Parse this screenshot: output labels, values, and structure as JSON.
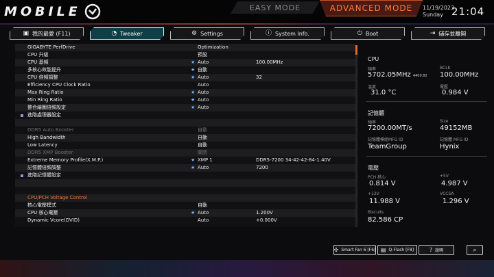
{
  "header": {
    "logo_text": "MOBILE",
    "mode_easy": "EASY MODE",
    "mode_advanced": "ADVANCED MODE",
    "date": "11/19/2023",
    "weekday": "Sunday",
    "time": "21:04"
  },
  "tabs": [
    {
      "label": "我的最愛 (F11)",
      "icon": "folder-icon",
      "active": false
    },
    {
      "label": "Tweaker",
      "icon": "speedometer-icon",
      "active": true
    },
    {
      "label": "Settings",
      "icon": "gear-icon",
      "active": false
    },
    {
      "label": "System Info.",
      "icon": "info-icon",
      "active": false
    },
    {
      "label": "Boot",
      "icon": "power-icon",
      "active": false
    },
    {
      "label": "儲存並離開",
      "icon": "exit-icon",
      "active": false
    }
  ],
  "settings": {
    "rows": [
      {
        "label": "GIGABYTE PerfDrive",
        "star": false,
        "value": "Optimization",
        "extra": ""
      },
      {
        "label": "CPU 升級",
        "star": false,
        "value": "預設",
        "extra": ""
      },
      {
        "label": "CPU 基頻",
        "star": true,
        "value": "Auto",
        "extra": "100.00MHz"
      },
      {
        "label": "多核心效能提升",
        "star": true,
        "value": "自動",
        "extra": ""
      },
      {
        "label": "CPU 倍頻調整",
        "star": true,
        "value": "Auto",
        "extra": "32"
      },
      {
        "label": "Efficiency CPU Clock Ratio",
        "star": false,
        "value": "Auto",
        "extra": ""
      },
      {
        "label": "Max Ring Ratio",
        "star": true,
        "value": "Auto",
        "extra": ""
      },
      {
        "label": "Min Ring Ratio",
        "star": true,
        "value": "Auto",
        "extra": ""
      },
      {
        "label": "整合繪圖倍頻設定",
        "star": true,
        "value": "Auto",
        "extra": ""
      },
      {
        "label": "進階處理器設定",
        "star": false,
        "value": "",
        "extra": ""
      },
      {
        "label": "",
        "star": false,
        "value": "",
        "extra": ""
      },
      {
        "label": "DDR5 Auto Booster",
        "star": false,
        "value": "自動",
        "extra": ""
      },
      {
        "label": "High Bandwidth",
        "star": false,
        "value": "自動",
        "extra": ""
      },
      {
        "label": "Low Latency",
        "star": false,
        "value": "自動",
        "extra": ""
      },
      {
        "label": "DDR5 XMP Booster",
        "star": false,
        "value": "關閉",
        "extra": ""
      },
      {
        "label": "Extreme Memory Profile(X.M.P.)",
        "star": true,
        "value": "XMP 1",
        "extra": "DDR5-7200 34-42-42-84-1.40V"
      },
      {
        "label": "記憶體倍頻調整",
        "star": true,
        "value": "Auto",
        "extra": "7200"
      },
      {
        "label": "進階記憶體設定",
        "star": false,
        "value": "",
        "extra": ""
      },
      {
        "label": "",
        "star": false,
        "value": "",
        "extra": ""
      },
      {
        "label": "CPU/PCH Voltage Control",
        "star": false,
        "value": "",
        "extra": ""
      },
      {
        "label": "核心電壓模式",
        "star": false,
        "value": "自動",
        "extra": ""
      },
      {
        "label": "CPU 核心電壓",
        "star": true,
        "value": "Auto",
        "extra": "1.200V"
      },
      {
        "label": "Dynamic Vcore(DVID)",
        "star": false,
        "value": "Auto",
        "extra": "+0.000V"
      }
    ]
  },
  "info": {
    "cpu": {
      "title": "CPU",
      "freq_label": "頻率",
      "freq_value": "5702.05MHz",
      "freq_sub": "4400.82",
      "bclk_label": "BCLK",
      "bclk_value": "100.00MHz",
      "temp_label": "溫度",
      "temp_value": "31.0 °C",
      "volt_label": "電壓",
      "volt_value": "0.984 V"
    },
    "memory": {
      "title": "記憶體",
      "freq_label": "頻率",
      "freq_value": "7200.00MT/s",
      "size_label": "Size",
      "size_value": "49152MB",
      "mfg_label": "記憶體模組MFG ID",
      "mfg_value": "TeamGroup",
      "mfg2_label": "記憶體 MFG ID",
      "mfg2_value": "Hynix"
    },
    "voltage": {
      "title": "電壓",
      "pch_label": "PCH 核心",
      "pch_value": "0.814 V",
      "p5_label": "+5V",
      "p5_value": "4.987 V",
      "p12_label": "+12V",
      "p12_value": "11.988 V",
      "vccsa_label": "VCCSA",
      "vccsa_value": "1.296 V",
      "biscuits_label": "Biscuits",
      "biscuits_value": "82.586 CP"
    }
  },
  "bottom": {
    "smartfan": "Smart Fan 6 [F6]",
    "qflash": "Q-Flash [F8]",
    "help": "說明"
  },
  "colors": {
    "accent_orange": "#e06a30",
    "active_tab": "#c2ffff",
    "star_blue": "#79b6ff",
    "bullet_purple": "#9a8ce6"
  }
}
